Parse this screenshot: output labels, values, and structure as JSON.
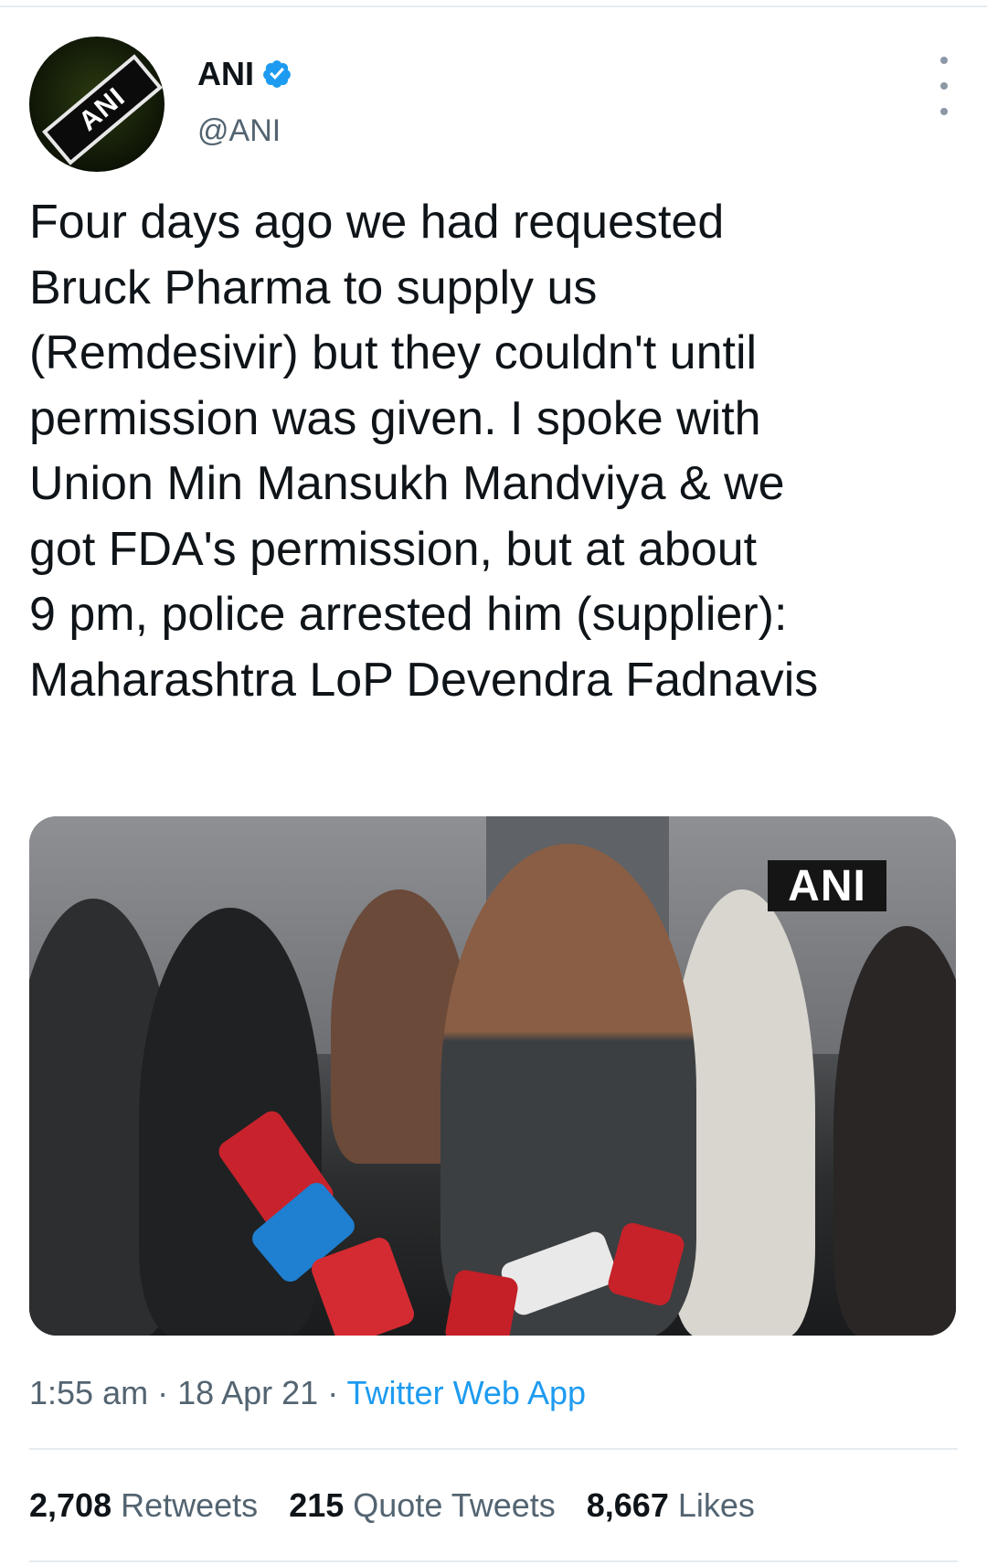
{
  "tweet": {
    "author_name": "ANI",
    "author_handle": "@ANI",
    "avatar_text": "ANI",
    "text": "Four days ago we had requested\nBruck Pharma to supply us\n(Remdesivir) but they couldn't until\npermission was given. I spoke with\nUnion Min Mansukh Mandviya & we\ngot FDA's permission, but at about\n9 pm, police arrested him (supplier):\nMaharashtra LoP Devendra Fadnavis",
    "media_watermark": "ANI",
    "time": "1:55 am",
    "separator": " · ",
    "date": "18 Apr 21",
    "source": "Twitter Web App"
  },
  "stats": {
    "retweets_count": "2,708",
    "retweets_label": "Retweets",
    "quotes_count": "215",
    "quotes_label": "Quote Tweets",
    "likes_count": "8,667",
    "likes_label": "Likes"
  },
  "icons": {
    "verified": "verified-badge-icon",
    "more": "more-options-icon"
  },
  "colors": {
    "link": "#1d9bf0",
    "secondary_text": "#536471",
    "primary_text": "#0f1419",
    "divider": "#e6ecf0"
  }
}
